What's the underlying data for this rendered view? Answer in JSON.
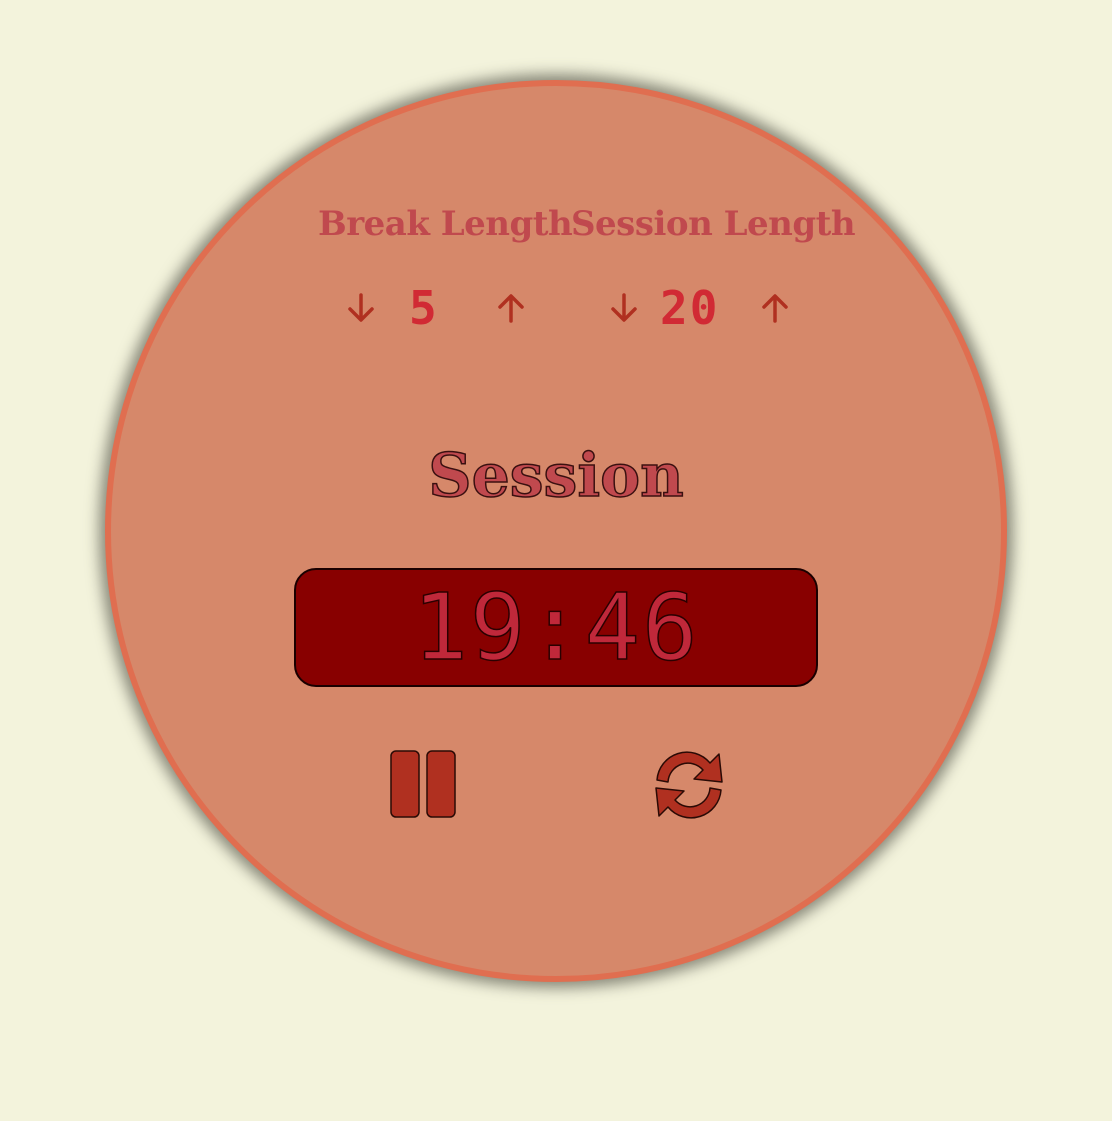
{
  "break": {
    "label": "Break Length",
    "value": "5",
    "decrement_icon": "arrow-down-icon",
    "increment_icon": "arrow-up-icon"
  },
  "session": {
    "label": "Session Length",
    "value": "20",
    "decrement_icon": "arrow-down-icon",
    "increment_icon": "arrow-up-icon"
  },
  "timer": {
    "label": "Session",
    "time_left": "19:46"
  },
  "controls": {
    "pause_icon": "pause-icon",
    "reset_icon": "refresh-icon"
  },
  "colors": {
    "background": "#f3f3dc",
    "clock_face": "#d6886a",
    "clock_rim": "#e06e50",
    "label_text": "#c0494e",
    "number_text": "#d12a34",
    "display_bg": "#880000",
    "icon_fill": "#b03020"
  }
}
